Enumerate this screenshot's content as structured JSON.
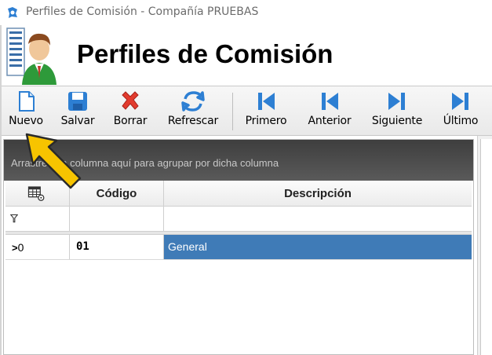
{
  "window": {
    "title": "Perfiles de Comisión - Compañía PRUEBAS",
    "app_icon": "blue-app-icon"
  },
  "header": {
    "title": "Perfiles de Comisión",
    "icon": "user-list-icon"
  },
  "toolbar": {
    "buttons": [
      {
        "label": "Nuevo",
        "icon": "new-document-icon"
      },
      {
        "label": "Salvar",
        "icon": "save-disk-icon"
      },
      {
        "label": "Borrar",
        "icon": "delete-x-icon"
      },
      {
        "label": "Refrescar",
        "icon": "refresh-icon"
      },
      {
        "label": "Primero",
        "icon": "first-record-icon"
      },
      {
        "label": "Anterior",
        "icon": "previous-record-icon"
      },
      {
        "label": "Siguiente",
        "icon": "next-record-icon"
      },
      {
        "label": "Último",
        "icon": "last-record-icon"
      }
    ]
  },
  "grid": {
    "group_panel_text": "Arrastre una columna aquí para agrupar por dicha columna",
    "columns": [
      "Código",
      "Descripción"
    ],
    "rows": [
      {
        "indicator": "0",
        "codigo": "01",
        "descripcion": "General"
      }
    ]
  },
  "colors": {
    "selected_cell": "#3f7bb7",
    "group_bar": "#4a4a4a",
    "icon_blue": "#2d7fd3",
    "delete_red": "#e23b2e",
    "annotation_arrow": "#f7c400"
  }
}
